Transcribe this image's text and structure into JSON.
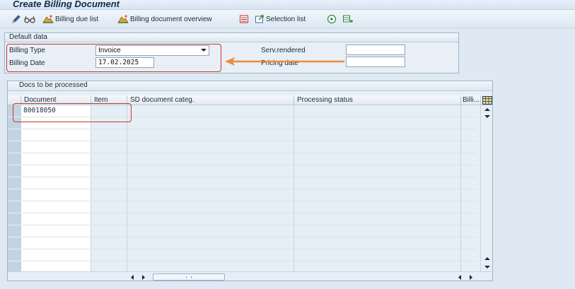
{
  "window": {
    "title": "Create Billing Document"
  },
  "toolbar": {
    "items": [
      {
        "icon": "pencil-icon"
      },
      {
        "icon": "glasses-icon"
      },
      {
        "icon": "mountain-icon",
        "label": "Billing due list"
      },
      {
        "icon": "mountain-icon",
        "label": "Billing document overview"
      },
      {
        "icon": "list-icon"
      },
      {
        "icon": "export-icon",
        "label": "Selection list"
      },
      {
        "icon": "execute-icon"
      },
      {
        "icon": "layout-icon"
      }
    ]
  },
  "default_data": {
    "header": "Default data",
    "billing_type_label": "Billing Type",
    "billing_type_value": "Invoice",
    "billing_date_label": "Billing Date",
    "billing_date_value": "17.02.2025",
    "serv_rendered_label": "Serv.rendered",
    "serv_rendered_value": "",
    "pricing_date_label": "Pricing date",
    "pricing_date_value": ""
  },
  "docs": {
    "header": "Docs to be processed",
    "columns": [
      "Document",
      "Item",
      "SD document categ.",
      "Processing status",
      "Billi..."
    ],
    "rows": [
      {
        "document": "80018050",
        "item": "",
        "category": "",
        "status": "",
        "billing": ""
      }
    ]
  },
  "colors": {
    "background": "#dfe9f3",
    "annotation_red": "#c0392b",
    "annotation_arrow": "#f08a3a"
  }
}
